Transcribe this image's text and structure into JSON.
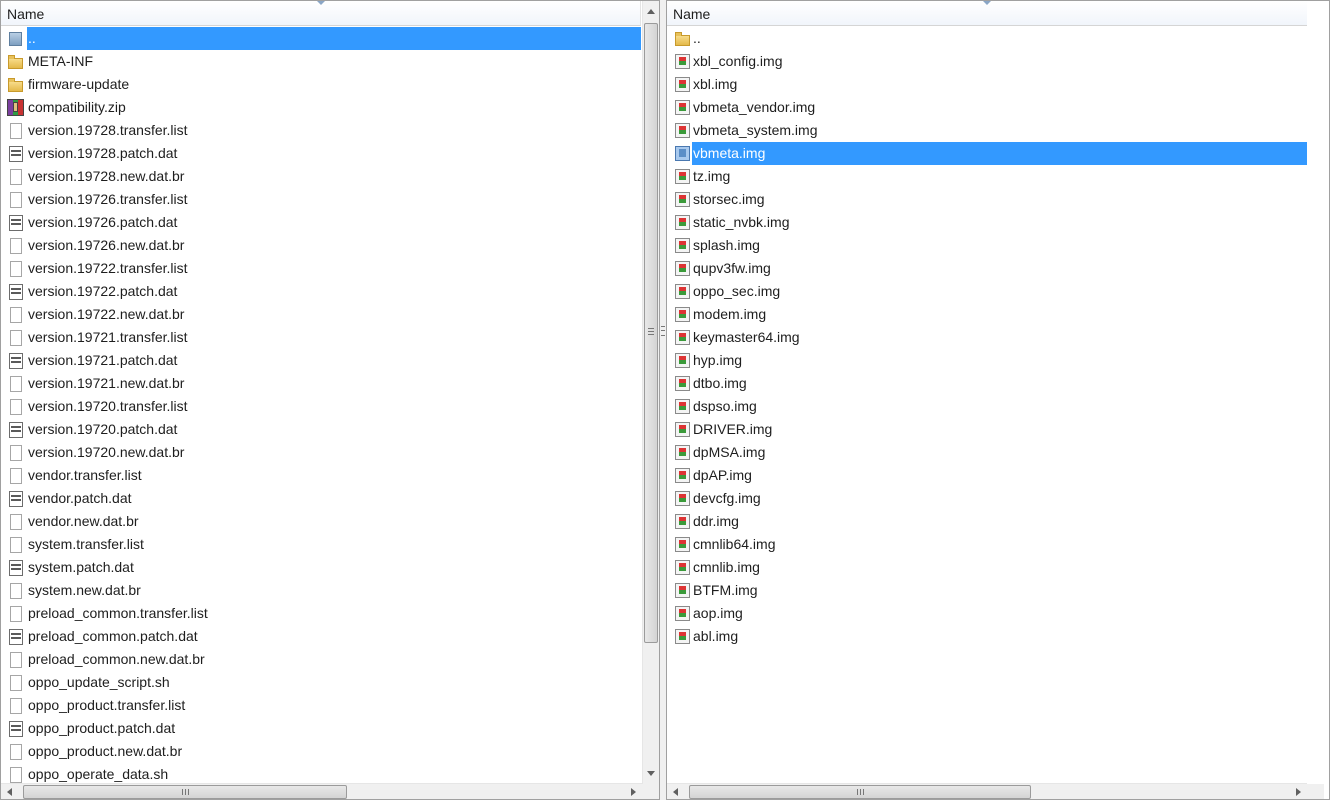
{
  "left_pane": {
    "header": {
      "name_label": "Name"
    },
    "items": [
      {
        "label": "..",
        "icon": "up-folder-icon",
        "selected": true
      },
      {
        "label": "META-INF",
        "icon": "folder-icon"
      },
      {
        "label": "firmware-update",
        "icon": "folder-icon"
      },
      {
        "label": "compatibility.zip",
        "icon": "zip-archive-icon"
      },
      {
        "label": "version.19728.transfer.list",
        "icon": "file-icon"
      },
      {
        "label": "version.19728.patch.dat",
        "icon": "dat-file-icon"
      },
      {
        "label": "version.19728.new.dat.br",
        "icon": "file-icon"
      },
      {
        "label": "version.19726.transfer.list",
        "icon": "file-icon"
      },
      {
        "label": "version.19726.patch.dat",
        "icon": "dat-file-icon"
      },
      {
        "label": "version.19726.new.dat.br",
        "icon": "file-icon"
      },
      {
        "label": "version.19722.transfer.list",
        "icon": "file-icon"
      },
      {
        "label": "version.19722.patch.dat",
        "icon": "dat-file-icon"
      },
      {
        "label": "version.19722.new.dat.br",
        "icon": "file-icon"
      },
      {
        "label": "version.19721.transfer.list",
        "icon": "file-icon"
      },
      {
        "label": "version.19721.patch.dat",
        "icon": "dat-file-icon"
      },
      {
        "label": "version.19721.new.dat.br",
        "icon": "file-icon"
      },
      {
        "label": "version.19720.transfer.list",
        "icon": "file-icon"
      },
      {
        "label": "version.19720.patch.dat",
        "icon": "dat-file-icon"
      },
      {
        "label": "version.19720.new.dat.br",
        "icon": "file-icon"
      },
      {
        "label": "vendor.transfer.list",
        "icon": "file-icon"
      },
      {
        "label": "vendor.patch.dat",
        "icon": "dat-file-icon"
      },
      {
        "label": "vendor.new.dat.br",
        "icon": "file-icon"
      },
      {
        "label": "system.transfer.list",
        "icon": "file-icon"
      },
      {
        "label": "system.patch.dat",
        "icon": "dat-file-icon"
      },
      {
        "label": "system.new.dat.br",
        "icon": "file-icon"
      },
      {
        "label": "preload_common.transfer.list",
        "icon": "file-icon"
      },
      {
        "label": "preload_common.patch.dat",
        "icon": "dat-file-icon"
      },
      {
        "label": "preload_common.new.dat.br",
        "icon": "file-icon"
      },
      {
        "label": "oppo_update_script.sh",
        "icon": "file-icon"
      },
      {
        "label": "oppo_product.transfer.list",
        "icon": "file-icon"
      },
      {
        "label": "oppo_product.patch.dat",
        "icon": "dat-file-icon"
      },
      {
        "label": "oppo_product.new.dat.br",
        "icon": "file-icon"
      },
      {
        "label": "oppo_operate_data.sh",
        "icon": "file-icon"
      }
    ]
  },
  "right_pane": {
    "header": {
      "name_label": "Name"
    },
    "items": [
      {
        "label": "..",
        "icon": "folder-icon"
      },
      {
        "label": "xbl_config.img",
        "icon": "disk-image-icon"
      },
      {
        "label": "xbl.img",
        "icon": "disk-image-icon"
      },
      {
        "label": "vbmeta_vendor.img",
        "icon": "disk-image-icon"
      },
      {
        "label": "vbmeta_system.img",
        "icon": "disk-image-icon"
      },
      {
        "label": "vbmeta.img",
        "icon": "disk-image-icon",
        "selected": true
      },
      {
        "label": "tz.img",
        "icon": "disk-image-icon"
      },
      {
        "label": "storsec.img",
        "icon": "disk-image-icon"
      },
      {
        "label": "static_nvbk.img",
        "icon": "disk-image-icon"
      },
      {
        "label": "splash.img",
        "icon": "disk-image-icon"
      },
      {
        "label": "qupv3fw.img",
        "icon": "disk-image-icon"
      },
      {
        "label": "oppo_sec.img",
        "icon": "disk-image-icon"
      },
      {
        "label": "modem.img",
        "icon": "disk-image-icon"
      },
      {
        "label": "keymaster64.img",
        "icon": "disk-image-icon"
      },
      {
        "label": "hyp.img",
        "icon": "disk-image-icon"
      },
      {
        "label": "dtbo.img",
        "icon": "disk-image-icon"
      },
      {
        "label": "dspso.img",
        "icon": "disk-image-icon"
      },
      {
        "label": "DRIVER.img",
        "icon": "disk-image-icon"
      },
      {
        "label": "dpMSA.img",
        "icon": "disk-image-icon"
      },
      {
        "label": "dpAP.img",
        "icon": "disk-image-icon"
      },
      {
        "label": "devcfg.img",
        "icon": "disk-image-icon"
      },
      {
        "label": "ddr.img",
        "icon": "disk-image-icon"
      },
      {
        "label": "cmnlib64.img",
        "icon": "disk-image-icon"
      },
      {
        "label": "cmnlib.img",
        "icon": "disk-image-icon"
      },
      {
        "label": "BTFM.img",
        "icon": "disk-image-icon"
      },
      {
        "label": "aop.img",
        "icon": "disk-image-icon"
      },
      {
        "label": "abl.img",
        "icon": "disk-image-icon"
      }
    ]
  },
  "colors": {
    "selection": "#3399ff",
    "selection_text": "#ffffff",
    "text": "#1e1e1e",
    "window_bg": "#ffffff",
    "chrome_bg": "#f0f0f0"
  }
}
